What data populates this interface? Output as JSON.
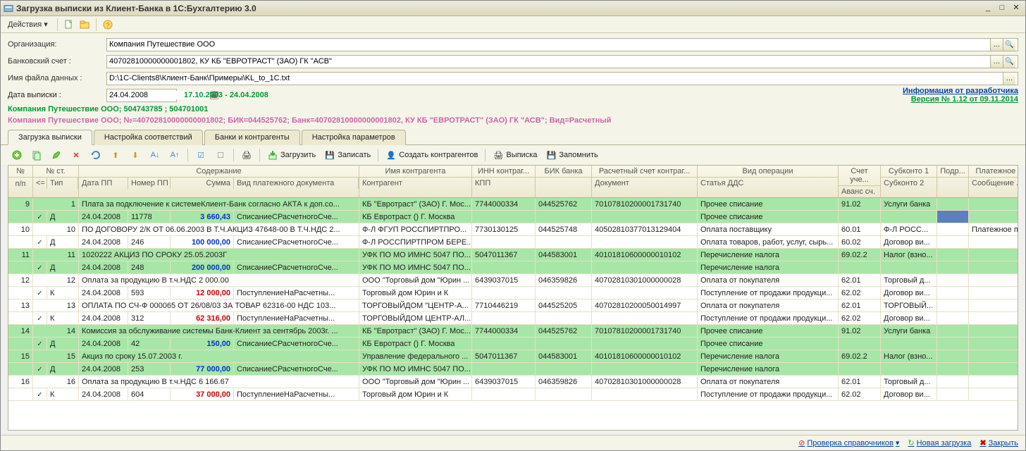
{
  "window": {
    "title": "Загрузка выписки из Клиент-Банка в 1С:Бухгалтерию 3.0"
  },
  "menu": {
    "actions": "Действия"
  },
  "form": {
    "org_label": "Организация:",
    "org_value": "Компания Путешествие ООО",
    "account_label": "Банковский счет :",
    "account_value": "40702810000000001802, КУ КБ \"ЕВРОТРАСТ\" (ЗАО) ГК \"АСВ\"",
    "file_label": "Имя файла данных :",
    "file_value": "D:\\1C-Clients8\\Клиент-Банк\\Примеры\\KL_to_1C.txt",
    "date_label": "Дата выписки :",
    "date_value": "24.04.2008",
    "date_range": "17.10.2003 - 24.04.2008",
    "dev_info": "Информация от разработчика",
    "version": "Версия № 1.12 от 09.11.2014"
  },
  "info_line1": "Компания Путешествие ООО; 504743785 ; 504701001",
  "info_line2": "Компания Путешествие ООО; №=40702810000000001802; БИК=044525762; Банк=40702810000000001802, КУ КБ \"ЕВРОТРАСТ\" (ЗАО) ГК \"АСВ\"; Вид=Расчетный",
  "tabs": [
    "Загрузка выписки",
    "Настройка соответствий",
    "Банки и контрагенты",
    "Настройка параметров"
  ],
  "toolbar": {
    "load": "Загрузить",
    "save": "Записать",
    "create": "Создать контрагентов",
    "statement": "Выписка",
    "remember": "Запомнить"
  },
  "headers": {
    "npp": "№ п/п",
    "nst": "№ ст.",
    "content": "Содержание",
    "contragent": "Имя контрагента",
    "inn": "ИНН контраг...",
    "bik": "БИК банка",
    "rs": "Расчетный счет контраг...",
    "op": "Вид операции",
    "account": "Счет уче...",
    "sub1": "Субконто 1",
    "podr": "Подр...",
    "pp": "Платежное п...",
    "lt": "<=",
    "tip": "Тип",
    "datepp": "Дата ПП",
    "nompp": "Номер ПП",
    "sum": "Сумма",
    "vidpd": "Вид платежного документа",
    "contragent2": "Контрагент",
    "kpp": "КПП",
    "empty": "",
    "doc": "Документ",
    "dds": "Статья ДДС",
    "avans": "Аванс сч.",
    "sub2": "Субконто 2",
    "msg": "Сообщение ..."
  },
  "rows": [
    {
      "g": 1,
      "c": [
        "9",
        "1",
        "Плата за подключение к системеКлиент-Банк согласно АКТА к доп.со...",
        "КБ \"Евротраст\" (ЗАО) Г. Мос...",
        "7744000334",
        "044525762",
        "70107810200001731740",
        "Прочее списание",
        "91.02",
        "Услуги банка",
        "",
        ""
      ]
    },
    {
      "g": 1,
      "c": [
        "",
        "",
        "",
        "",
        "",
        "",
        "",
        "Прочее списание",
        "",
        "",
        "",
        ""
      ],
      "d": [
        "✓",
        "Д",
        "24.04.2008",
        "11778",
        "3 660,43",
        "СписаниеСРасчетногоСче...",
        "КБ Евротраст () Г. Москва"
      ],
      "ac": "blue",
      "hlpodr": true
    },
    {
      "g": 0,
      "c": [
        "10",
        "10",
        "ПО ДОГОВОРУ 2/К ОТ 06.06.2003 В Т.Ч.АКЦИЗ 47648-00 В Т.Ч.НДС 2...",
        "Ф-Л ФГУП РОССПИРТПРО...",
        "7730130125",
        "044525748",
        "40502810377013129404",
        "Оплата поставщику",
        "60.01",
        "Ф-Л РОСС...",
        "",
        "Платежное п..."
      ]
    },
    {
      "g": 0,
      "c": [
        "",
        "",
        "",
        "",
        "",
        "",
        "",
        "Оплата товаров, работ, услуг, сырь...",
        "60.02",
        "Договор ви...",
        "",
        ""
      ],
      "d": [
        "✓",
        "Д",
        "24.04.2008",
        "246",
        "100 000,00",
        "СписаниеСРасчетногоСче...",
        "Ф-Л РОССПИРТПРОМ БЕРЕ..."
      ],
      "ac": "blue"
    },
    {
      "g": 1,
      "c": [
        "11",
        "11",
        "1020222 АКЦИЗ ПО СРОКУ 25.05.2003Г",
        "УФК ПО МО ИМНС 5047 ПО...",
        "5047011367",
        "044583001",
        "40101810600000010102",
        "Перечисление налога",
        "69.02.2",
        "Налог (взно...",
        "",
        ""
      ]
    },
    {
      "g": 1,
      "c": [
        "",
        "",
        "",
        "",
        "",
        "",
        "",
        "Перечисление налога",
        "",
        "",
        "",
        ""
      ],
      "d": [
        "✓",
        "Д",
        "24.04.2008",
        "248",
        "200 000,00",
        "СписаниеСРасчетногоСче...",
        "УФК ПО МО ИМНС 5047 ПО..."
      ],
      "ac": "blue"
    },
    {
      "g": 0,
      "c": [
        "12",
        "12",
        "Оплата за продукцию    В т.ч.НДС 2 000.00",
        "ООО \"Торговый дом \"Юрин ...",
        "6439037015",
        "046359826",
        "40702810301000000028",
        "Оплата от покупателя",
        "62.01",
        "Торговый д...",
        "",
        ""
      ]
    },
    {
      "g": 0,
      "c": [
        "",
        "",
        "",
        "",
        "",
        "",
        "",
        "Поступление от продажи продукци...",
        "62.02",
        "Договор ви...",
        "",
        ""
      ],
      "d": [
        "✓",
        "К",
        "24.04.2008",
        "593",
        "12 000,00",
        "ПоступлениеНаРасчетны...",
        "Торговый дом Юрин и К"
      ],
      "ac": "red"
    },
    {
      "g": 0,
      "c": [
        "13",
        "13",
        "ОПЛАТА ПО СЧ-Ф 000065 ОТ 26/08/03 ЗА ТОВАР  62316-00 НДС 103...",
        "ТОРГОВЫЙДОМ \"ЦЕНТР-А...",
        "7710446219",
        "044525205",
        "40702810200050014997",
        "Оплата от покупателя",
        "62.01",
        "ТОРГОВЫЙ...",
        "",
        ""
      ]
    },
    {
      "g": 0,
      "c": [
        "",
        "",
        "",
        "",
        "",
        "",
        "",
        "Поступление от продажи продукци...",
        "62.02",
        "Договор ви...",
        "",
        ""
      ],
      "d": [
        "✓",
        "К",
        "24.04.2008",
        "312",
        "62 316,00",
        "ПоступлениеНаРасчетны...",
        "ТОРГОВЫЙДОМ ЦЕНТР-АЛ..."
      ],
      "ac": "red"
    },
    {
      "g": 1,
      "c": [
        "14",
        "14",
        "Комиссия за обслуживание системы Банк-Клиент за сентябрь 2003г. ...",
        "КБ \"Евротраст\" (ЗАО) Г. Мос...",
        "7744000334",
        "044525762",
        "70107810200001731740",
        "Прочее списание",
        "91.02",
        "Услуги банка",
        "",
        ""
      ]
    },
    {
      "g": 1,
      "c": [
        "",
        "",
        "",
        "",
        "",
        "",
        "",
        "Прочее списание",
        "",
        "",
        "",
        ""
      ],
      "d": [
        "✓",
        "Д",
        "24.04.2008",
        "42",
        "150,00",
        "СписаниеСРасчетногоСче...",
        "КБ Евротраст () Г. Москва"
      ],
      "ac": "blue"
    },
    {
      "g": 1,
      "c": [
        "15",
        "15",
        "Акциз по сроку 15.07.2003 г.",
        "Управление федерального ...",
        "5047011367",
        "044583001",
        "40101810600000010102",
        "Перечисление налога",
        "69.02.2",
        "Налог (взно...",
        "",
        ""
      ]
    },
    {
      "g": 1,
      "c": [
        "",
        "",
        "",
        "",
        "",
        "",
        "",
        "Перечисление налога",
        "",
        "",
        "",
        ""
      ],
      "d": [
        "✓",
        "Д",
        "24.04.2008",
        "253",
        "77 000,00",
        "СписаниеСРасчетногоСче...",
        "УФК ПО МО ИМНС 5047 ПО..."
      ],
      "ac": "blue"
    },
    {
      "g": 0,
      "c": [
        "16",
        "16",
        "Оплата за продукцию    В т.ч.НДС 6 166.67",
        "ООО \"Торговый дом \"Юрин ...",
        "6439037015",
        "046359826",
        "40702810301000000028",
        "Оплата от покупателя",
        "62.01",
        "Торговый д...",
        "",
        ""
      ]
    },
    {
      "g": 0,
      "c": [
        "",
        "",
        "",
        "",
        "",
        "",
        "",
        "Поступление от продажи продукци...",
        "62.02",
        "Договор ви...",
        "",
        ""
      ],
      "d": [
        "✓",
        "К",
        "24.04.2008",
        "604",
        "37 000,00",
        "ПоступлениеНаРасчетны...",
        "Торговый дом Юрин и К"
      ],
      "ac": "red"
    }
  ],
  "status": {
    "check": "Проверка справочников",
    "new": "Новая загрузка",
    "close": "Закрыть"
  },
  "cols": {
    "npp": 35,
    "lt": 20,
    "nst": 45,
    "tip": 28,
    "datepp": 70,
    "nompp": 60,
    "sum": 90,
    "vidpd": 150,
    "contragent": 160,
    "inn": 90,
    "bik": 80,
    "rs": 150,
    "op": 200,
    "account": 60,
    "sub1": 80,
    "podr": 45,
    "pp": 95
  }
}
